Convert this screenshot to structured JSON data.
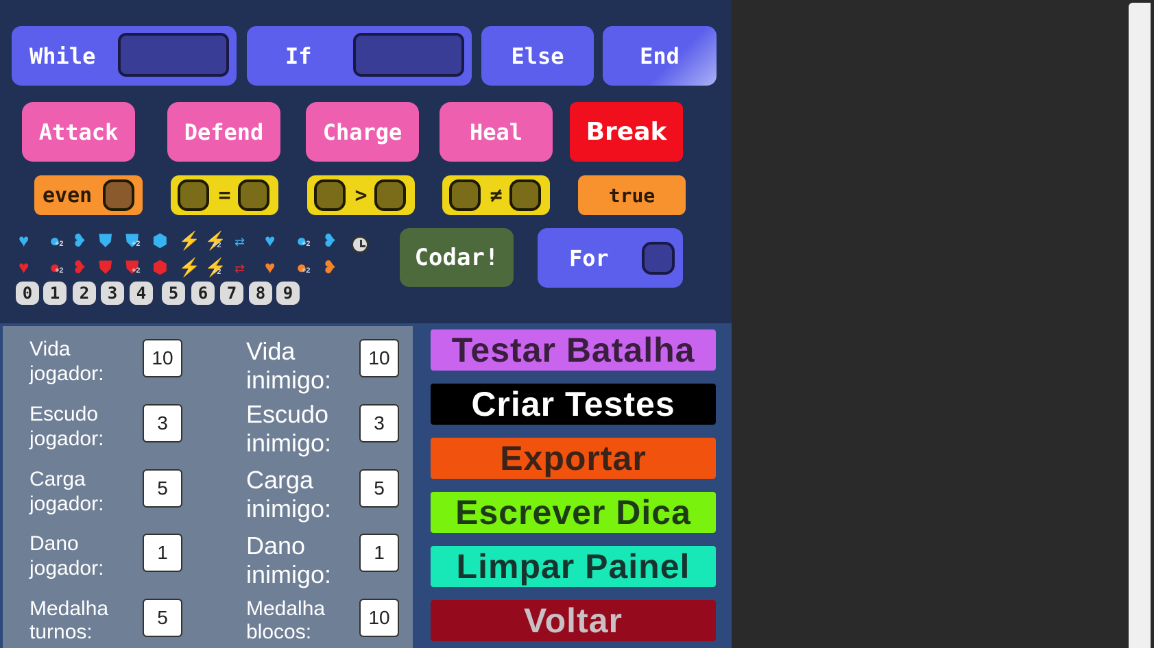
{
  "control_blocks": {
    "while": "While",
    "if": "If",
    "else": "Else",
    "end": "End",
    "for": "For"
  },
  "action_blocks": {
    "attack": "Attack",
    "defend": "Defend",
    "charge": "Charge",
    "heal": "Heal",
    "break": "Break"
  },
  "condition_blocks": {
    "even": "even",
    "equals_op": "=",
    "greater_op": ">",
    "not_equal_op": "≠",
    "true": "true"
  },
  "run_button": "Codar!",
  "icons": {
    "blue_row": [
      "heart-icon",
      "potion-icon",
      "heart-transfer-icon",
      "shield-icon",
      "shield-break-icon",
      "shield-transfer-icon",
      "charge-icon",
      "charge-plus-icon",
      "charge-transfer-icon",
      "heart-icon",
      "potion-icon",
      "heart-transfer-icon",
      "clock-icon"
    ],
    "red_row": [
      "heart-icon",
      "potion-icon",
      "heart-transfer-icon",
      "shield-icon",
      "shield-break-icon",
      "shield-transfer-icon",
      "charge-icon",
      "charge-plus-icon",
      "charge-transfer-icon",
      "heart-icon",
      "potion-icon",
      "heart-transfer-icon"
    ],
    "plus_badge": "+2",
    "colors": {
      "blue": "#38b3f1",
      "red": "#e7272d",
      "orange": "#f5832a"
    }
  },
  "digits": [
    "0",
    "1",
    "2",
    "3",
    "4",
    "5",
    "6",
    "7",
    "8",
    "9"
  ],
  "player": {
    "life_label": "Vida\njogador:",
    "life": "10",
    "shield_label": "Escudo\njogador:",
    "shield": "3",
    "charge_label": "Carga\njogador:",
    "charge": "5",
    "damage_label": "Dano\njogador:",
    "damage": "1",
    "medal_turns_label": "Medalha\nturnos:",
    "medal_turns": "5"
  },
  "enemy": {
    "life_label": "Vida\ninimigo:",
    "life": "10",
    "shield_label": "Escudo\ninimigo:",
    "shield": "3",
    "charge_label": "Carga\ninimigo:",
    "charge": "5",
    "damage_label": "Dano\ninimigo:",
    "damage": "1",
    "medal_blocks_label": "Medalha\nblocos:",
    "medal_blocks": "10"
  },
  "actions": {
    "test_battle": "Testar Batalha",
    "create_tests": "Criar Testes",
    "export": "Exportar",
    "write_hint": "Escrever Dica",
    "clear_panel": "Limpar Painel",
    "back": "Voltar"
  },
  "action_colors": {
    "test_battle": "#c964ef",
    "create_tests": "#000000",
    "export": "#f1520e",
    "write_hint": "#79f20d",
    "clear_panel": "#18e8b8",
    "back": "#960a1e"
  }
}
